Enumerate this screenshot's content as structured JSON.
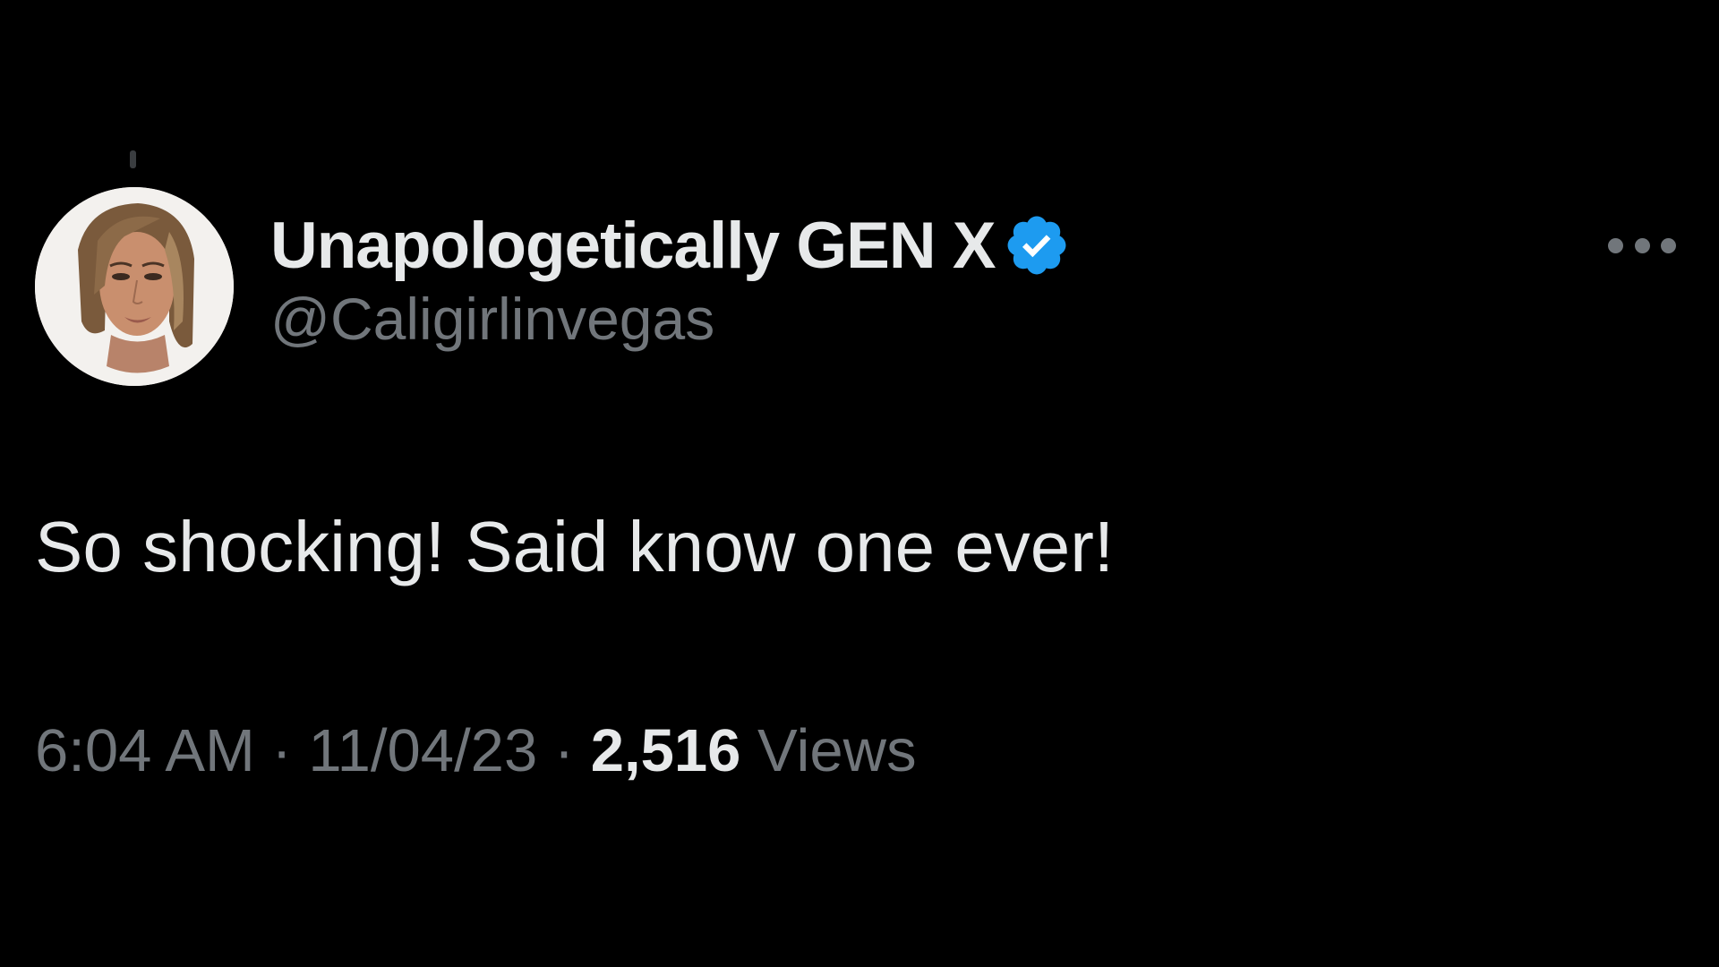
{
  "tweet": {
    "author": {
      "display_name": "Unapologetically GEN X",
      "handle": "@Caligirlinvegas",
      "verified": true,
      "avatar": "profile-photo"
    },
    "text": "So shocking! Said know one ever!",
    "meta": {
      "time": "6:04 AM",
      "separator_1": " · ",
      "date": "11/04/23",
      "separator_2": " · ",
      "views_count": "2,516",
      "views_label": " Views"
    },
    "more_icon": "more-horizontal-icon",
    "verified_icon": "verified-badge-icon"
  },
  "colors": {
    "background": "#000000",
    "primary_text": "#e7e9ea",
    "secondary_text": "#71767b",
    "verified_blue": "#1d9bf0"
  }
}
